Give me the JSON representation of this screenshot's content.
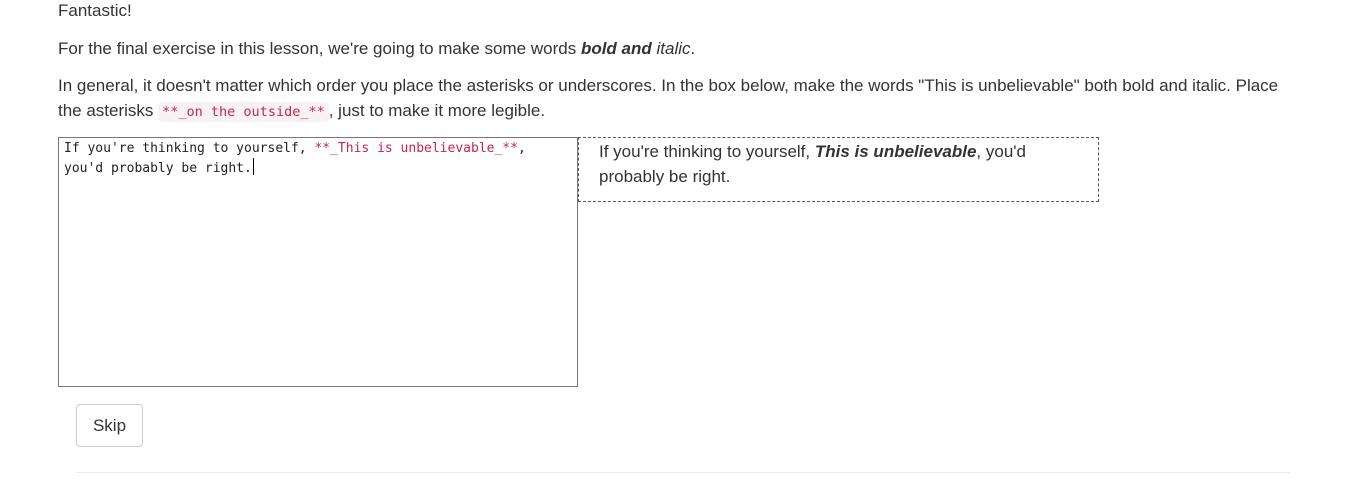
{
  "lesson": {
    "praise": "Fantastic!",
    "intro": {
      "before": "For the final exercise in this lesson, we're going to make some words ",
      "bold_italic_word": "bold",
      "and_word": " and",
      "space": " ",
      "italic_word": "italic",
      "end": "."
    },
    "instructions": {
      "line": "In general, it doesn't matter which order you place the asterisks or underscores. In the box below, make the words \"This is unbelievable\" both bold and italic. Place the asterisks ",
      "code": "**_on the outside_**",
      "after": ", just to make it more legible."
    }
  },
  "editor": {
    "text_before": "If you're thinking to yourself, ",
    "markdown": "**_This is unbelievable_**",
    "text_after": ",\nyou'd probably be right."
  },
  "preview": {
    "before": "If you're thinking to yourself, ",
    "bold_italic": "This is unbelievable",
    "after": ", you'd probably be right."
  },
  "actions": {
    "skip_label": "Skip"
  }
}
